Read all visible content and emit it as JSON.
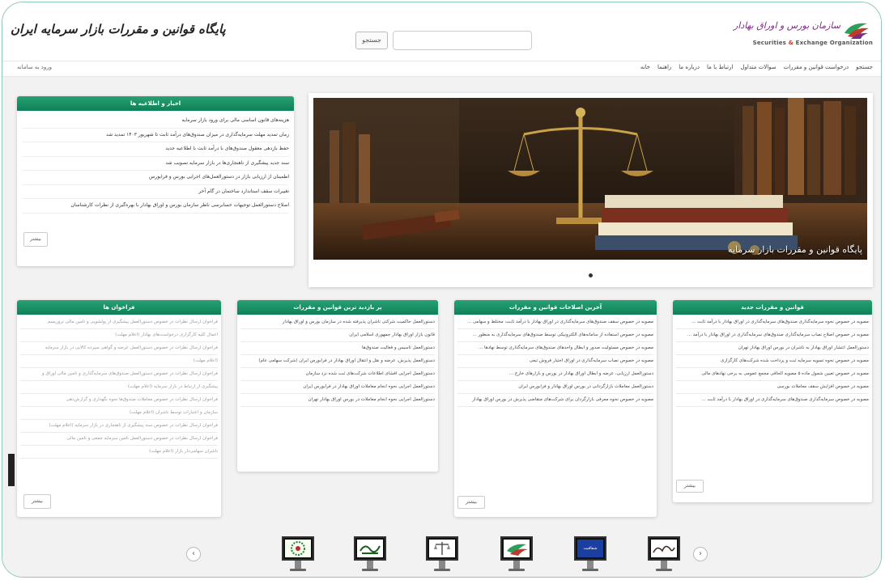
{
  "header": {
    "site_title": "پایگاه قوانین و مقررات بازار سرمایه ایران",
    "search_button_label": "جستجو",
    "search_placeholder": "",
    "logo_fa": "سازمان بورس و اوراق بهادار",
    "logo_en_1": "Securities",
    "logo_en_amp": " & ",
    "logo_en_2": "Exchange Organization"
  },
  "nav": {
    "items": [
      "خانه",
      "راهنما",
      "درباره ما",
      "ارتباط با ما",
      "سوالات متداول",
      "درخواست قوانین و مقررات",
      "جستجو"
    ],
    "login_label": "ورود به سامانه"
  },
  "news": {
    "title": "اخبار و اطلاعیه ها",
    "items": [
      "هزینه‌های قانون اساسی مالی برای ورود بازار سرمایه",
      "زمان تمدید مهلت سرمایه‌گذاری در میزان صندوق‌های درآمد ثابت تا شهریور ۱۴۰۳ تمدید شد",
      "حفظ بازدهی معقول صندوق‌های با درآمد ثابت با اطلاعیه جدید",
      "سند جدید پیشگیری از ناهنجاری‌ها در بازار سرمایه تصویب شد",
      "اطمینان از ارزیابی بازار در دستورالعمل‌های اجرایی بورس و فرابورس",
      "تغییرات سقف استاندارد ساختمان در گام آخر",
      "اصلاح دستورالعمل توجیهات حسابرسی ناظر سازمان بورس و اوراق بهادار با بهره‌گیری از نظرات کارشناسان"
    ],
    "more_label": "بیشتر"
  },
  "hero": {
    "caption": "پایگاه قوانین و مقررات بازار سرمایه"
  },
  "new_rules": {
    "title": "قوانین و مقررات جدید",
    "items": [
      "مصوبه در خصوص نحوه سرمایه‌گذاری صندوق‌های سرمایه‌گذاری در اوراق بهادار با درآمد ثابت ...",
      "مصوبه در خصوص اصلاح نصاب سرمایه‌گذاری صندوق‌های سرمایه‌گذاری در اوراق بهادار با درآمد ...",
      "دستورالعمل انتشار اوراق بهادار به ناشران در بورس اوراق بهادار تهران",
      "مصوبه در خصوص نحوه تسویه سرمایه ثبت و پرداخت شده شرکت‌های کارگزاری",
      "مصوبه در خصوص تعیین شمول ماده ۵ مصوبه الحاقی مجمع عمومی به برخی نهادهای مالی",
      "مصوبه در خصوص افزایش سقف معاملات بورسی",
      "مصوبه در خصوص سرمایه‌گذاری صندوق‌های سرمایه‌گذاری در اوراق بهادار با درآمد ثابت ..."
    ],
    "more_label": "بیشتر"
  },
  "latest_amend": {
    "title": "آخرین اصلاحات قوانین و مقررات",
    "items": [
      "مصوبه در خصوص سقف صندوق‌های سرمایه‌گذاری در اوراق بهادار با درآمد ثابت، مختلط و سهامی ...",
      "مصوبه در خصوص استفاده از سامانه‌های الکترونیکی توسط صندوق‌های سرمایه‌گذاری به منظور ...",
      "مصوبه در خصوص مسئولیت صدور و ابطال واحدهای صندوق‌های سرمایه‌گذاری توسط نهادها ...",
      "مصوبه در خصوص نصاب سرمایه‌گذاری در اوراق اختیار فروش تبعی",
      "دستورالعمل ارزیابی، عرضه و ابطال اوراق بهادار در بورس و بازارهای خارج ...",
      "دستورالعمل معاملات بازار‌گردانی در بورس اوراق بهادار و فرابورس ایران",
      "مصوبه در خصوص نحوه معرفی بازارگردان برای شرکت‌های متقاضی پذیرش در بورس اوراق بهادار"
    ],
    "more_label": "بیشتر"
  },
  "most_visited": {
    "title": "پر بازدید ترین قوانین و مقررات",
    "items": [
      "دستورالعمل حاکمیت شرکتی ناشران پذیرفته شده در سازمان بورس و اوراق بهادار",
      "قانون بازار اوراق بهادار جمهوری اسلامی ایران",
      "دستورالعمل تاسیس و فعالیت صندوق‌ها",
      "دستورالعمل پذیرش، عرضه و نقل و انتقال اوراق بهادار در فرابورس ایران (شرکت سهامی عام)",
      "دستورالعمل اجرایی افشای اطلاعات شرکت‌های ثبت شده نزد سازمان",
      "دستورالعمل اجرایی نحوه انجام معاملات اوراق بهادار در فرابورس ایران",
      "دستورالعمل اجرایی نحوه انجام معاملات در بورس اوراق بهادار تهران"
    ]
  },
  "calls": {
    "title": "فراخوان ها",
    "items": [
      "فراخوان ارسال نظرات در خصوص دستورالعمل پیشگیری از پولشویی و تامین مالی تروریسم",
      "اعمال کلیه کارگزاری درخواست‌های بهادار (اعلام مهلت)",
      "فراخوان ارسال نظرات در خصوص دستورالعمل عرضه و گواهی سپرده کالایی در بازار سرمایه",
      "(اعلام مهلت)",
      "فراخوان ارسال نظرات در خصوص دستورالعمل صندوق‌های سرمایه‌گذاری و تامین مالی اوراق و",
      "پیشگیری از ارتباط در بازار سرمایه (اعلام مهلت)",
      "فراخوان ارسال نظرات در خصوص معاملات صندوق‌ها نحوه نگهداری و گزارش‌دهی",
      "سازمان و اعتبارات توسط ناشران (اعلام مهلت)",
      "فراخوان ارسال نظرات در خصوص سند پیشگیری از ناهنجاری در بازار سرمایه (اعلام مهلت)",
      "فراخوان ارسال نظرات در خصوص دستورالعمل تامین سرمایه جمعی و تامین مالی",
      "ناشران سهامی‌دار بازار (اعلام مهلت)"
    ],
    "more_label": "بیشتر"
  },
  "carousel": {
    "prev": "‹",
    "next": "›",
    "logos": [
      "",
      "",
      "",
      "",
      "شفافیت",
      ""
    ]
  }
}
